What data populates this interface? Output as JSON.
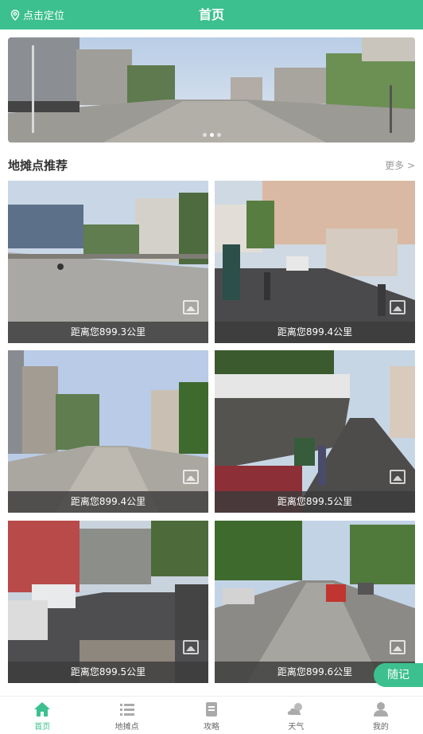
{
  "header": {
    "location_label": "点击定位",
    "title": "首页"
  },
  "banner": {
    "slide_count": 3,
    "active_index": 1
  },
  "section": {
    "title": "地摊点推荐",
    "more_label": "更多 >"
  },
  "spots": [
    {
      "distance": "距离您899.3公里"
    },
    {
      "distance": "距离您899.4公里"
    },
    {
      "distance": "距离您899.4公里"
    },
    {
      "distance": "距离您899.5公里"
    },
    {
      "distance": "距离您899.5公里"
    },
    {
      "distance": "距离您899.6公里"
    }
  ],
  "float_button": {
    "label": "随记"
  },
  "tabbar": {
    "tabs": [
      {
        "label": "首页",
        "icon": "home-icon",
        "active": true
      },
      {
        "label": "地摊点",
        "icon": "list-icon",
        "active": false
      },
      {
        "label": "攻略",
        "icon": "guide-icon",
        "active": false
      },
      {
        "label": "天气",
        "icon": "weather-icon",
        "active": false
      },
      {
        "label": "我的",
        "icon": "user-icon",
        "active": false
      }
    ]
  },
  "colors": {
    "accent": "#3cc08f"
  }
}
